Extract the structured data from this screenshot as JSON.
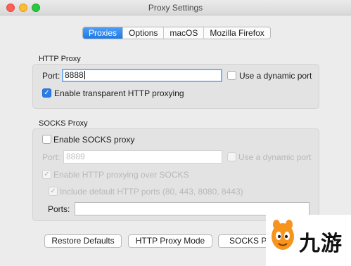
{
  "window": {
    "title": "Proxy Settings"
  },
  "tabs": [
    "Proxies",
    "Options",
    "macOS",
    "Mozilla Firefox"
  ],
  "http_proxy": {
    "group_label": "HTTP Proxy",
    "port_label": "Port:",
    "port_value": "8888",
    "dynamic_label": "Use a dynamic port",
    "dynamic_checked": false,
    "transparent_label": "Enable transparent HTTP proxying",
    "transparent_checked": true
  },
  "socks_proxy": {
    "group_label": "SOCKS Proxy",
    "enable_label": "Enable SOCKS proxy",
    "enable_checked": false,
    "port_label": "Port:",
    "port_placeholder": "8889",
    "dynamic_label": "Use a dynamic port",
    "http_over_socks_label": "Enable HTTP proxying over SOCKS",
    "include_ports_label": "Include default HTTP ports (80, 443, 8080, 8443)",
    "ports_label": "Ports:",
    "ports_value": ""
  },
  "buttons": {
    "restore": "Restore Defaults",
    "http_mode": "HTTP Proxy Mode",
    "socks_mode": "SOCKS Pro"
  },
  "watermark": {
    "text": "九游"
  },
  "colors": {
    "accent": "#2a7ce9",
    "focus_ring": "#7ab1f2"
  }
}
